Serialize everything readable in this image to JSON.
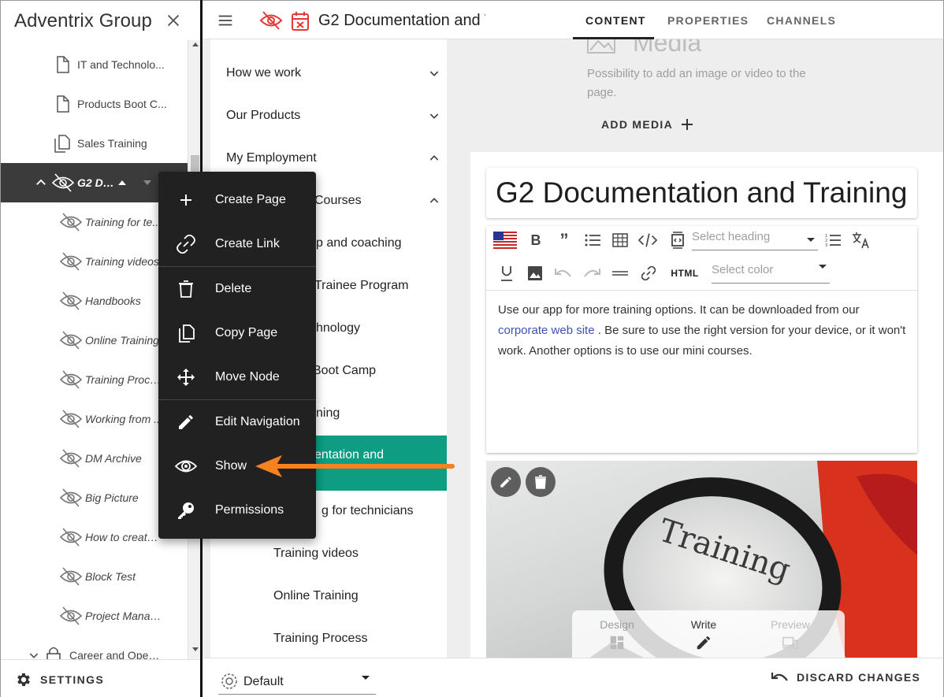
{
  "org_name": "Adventrix Group",
  "tree": {
    "items": [
      {
        "label": "IT and Technolo...",
        "icon": "document-icon"
      },
      {
        "label": "Products Boot C...",
        "icon": "document-icon"
      },
      {
        "label": "Sales Training",
        "icon": "documents-icon"
      },
      {
        "label": "G2 Do...",
        "icon": "hidden-icon"
      },
      {
        "label": "Training for te...",
        "icon": "hidden-icon"
      },
      {
        "label": "Training videos",
        "icon": "hidden-icon"
      },
      {
        "label": "Handbooks",
        "icon": "hidden-icon"
      },
      {
        "label": "Online Training",
        "icon": "hidden-icon"
      },
      {
        "label": "Training Proce...",
        "icon": "hidden-icon"
      },
      {
        "label": "Working from ...",
        "icon": "hidden-icon"
      },
      {
        "label": "DM Archive",
        "icon": "hidden-icon"
      },
      {
        "label": "Big Picture",
        "icon": "hidden-icon"
      },
      {
        "label": "How to create ...",
        "icon": "hidden-icon"
      },
      {
        "label": "Block Test",
        "icon": "hidden-icon"
      },
      {
        "label": "Project Manag...",
        "icon": "hidden-icon"
      },
      {
        "label": "Career and Open ...",
        "icon": "lock-icon"
      }
    ]
  },
  "settings_label": "SETTINGS",
  "topbar": {
    "page_title": "G2 Documentation and Training",
    "tabs": [
      "CONTENT",
      "PROPERTIES",
      "CHANNELS"
    ]
  },
  "nav": {
    "items": [
      {
        "label": "How we work"
      },
      {
        "label": "Our Products"
      },
      {
        "label": "My Employment"
      },
      {
        "label": "Courses"
      },
      {
        "label": "p and coaching"
      },
      {
        "label": "Trainee Program"
      },
      {
        "label": "hnology"
      },
      {
        "label": "Boot Camp"
      },
      {
        "label": "ning"
      },
      {
        "label": "entation and"
      },
      {
        "label": "g for technicians"
      },
      {
        "label": "Training videos"
      },
      {
        "label": "Online Training"
      },
      {
        "label": "Training Process"
      }
    ]
  },
  "media": {
    "title": "Media",
    "description": "Possibility to add an image or video to the page.",
    "add_label": "ADD MEDIA"
  },
  "editor": {
    "heading": "G2 Documentation and Training",
    "select_heading_placeholder": "Select heading",
    "html_label": "HTML",
    "select_color_placeholder": "Select color",
    "body_before": "Use our app for more training options. It can be downloaded from our",
    "body_link": "corporate web site",
    "body_after": ". Be sure to use the right version for your device, or it won't work. Another options is to use our mini courses."
  },
  "image": {
    "caption_word": "Training"
  },
  "modes": {
    "design": "Design",
    "write": "Write",
    "preview": "Preview"
  },
  "bottombar": {
    "profile": "Default",
    "discard": "DISCARD CHANGES"
  },
  "context_menu": {
    "items": [
      {
        "label": "Create Page",
        "icon": "plus-icon"
      },
      {
        "label": "Create Link",
        "icon": "link-icon"
      },
      {
        "label": "Delete",
        "icon": "trash-icon"
      },
      {
        "label": "Copy Page",
        "icon": "copy-icon"
      },
      {
        "label": "Move Node",
        "icon": "move-icon"
      },
      {
        "label": "Edit Navigation",
        "icon": "pencil-icon"
      },
      {
        "label": "Show",
        "icon": "eye-icon"
      },
      {
        "label": "Permissions",
        "icon": "key-icon"
      }
    ]
  },
  "colors": {
    "accent_teal": "#0e9d83",
    "hidden_red": "#e53935",
    "arrow_orange": "#f5821f",
    "menu_bg": "#212121"
  }
}
